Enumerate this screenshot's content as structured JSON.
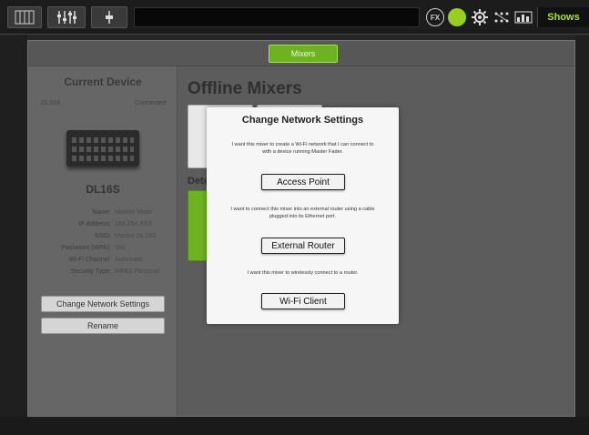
{
  "toolbar": {
    "fx_label": "FX",
    "shows_label": "Shows"
  },
  "panel": {
    "tab_label": "Mixers"
  },
  "current_device": {
    "heading": "Current Device",
    "model_small": "DL16S",
    "status_small": "Connected",
    "name": "DL16S",
    "info": [
      {
        "key": "Name:",
        "value": "Mackie Mixer"
      },
      {
        "key": "IP Address:",
        "value": "169.254.XXX"
      },
      {
        "key": "SSID:",
        "value": "Mackie DL16S"
      },
      {
        "key": "Password (WPA):",
        "value": "Yes"
      },
      {
        "key": "Wi-Fi Channel:",
        "value": "Automatic"
      },
      {
        "key": "Security Type:",
        "value": "WPA2 Personal"
      }
    ],
    "change_network_btn": "Change Network Settings",
    "rename_btn": "Rename"
  },
  "right": {
    "title": "Offline Mixers",
    "detected_label": "Dete"
  },
  "dialog": {
    "title": "Change Network Settings",
    "option1_desc": "I want this mixer to create a Wi-Fi network that I can connect to with a device running Master Fader.",
    "option1_btn": "Access Point",
    "option2_desc": "I want to connect this mixer into an external router using a cable plugged into its Ethernet port.",
    "option2_btn": "External Router",
    "option3_desc": "I want this mixer to wirelessly connect to a router.",
    "option3_btn": "Wi-Fi Client"
  },
  "colors": {
    "accent_green": "#6db320",
    "shows_text": "#a6e22e"
  }
}
